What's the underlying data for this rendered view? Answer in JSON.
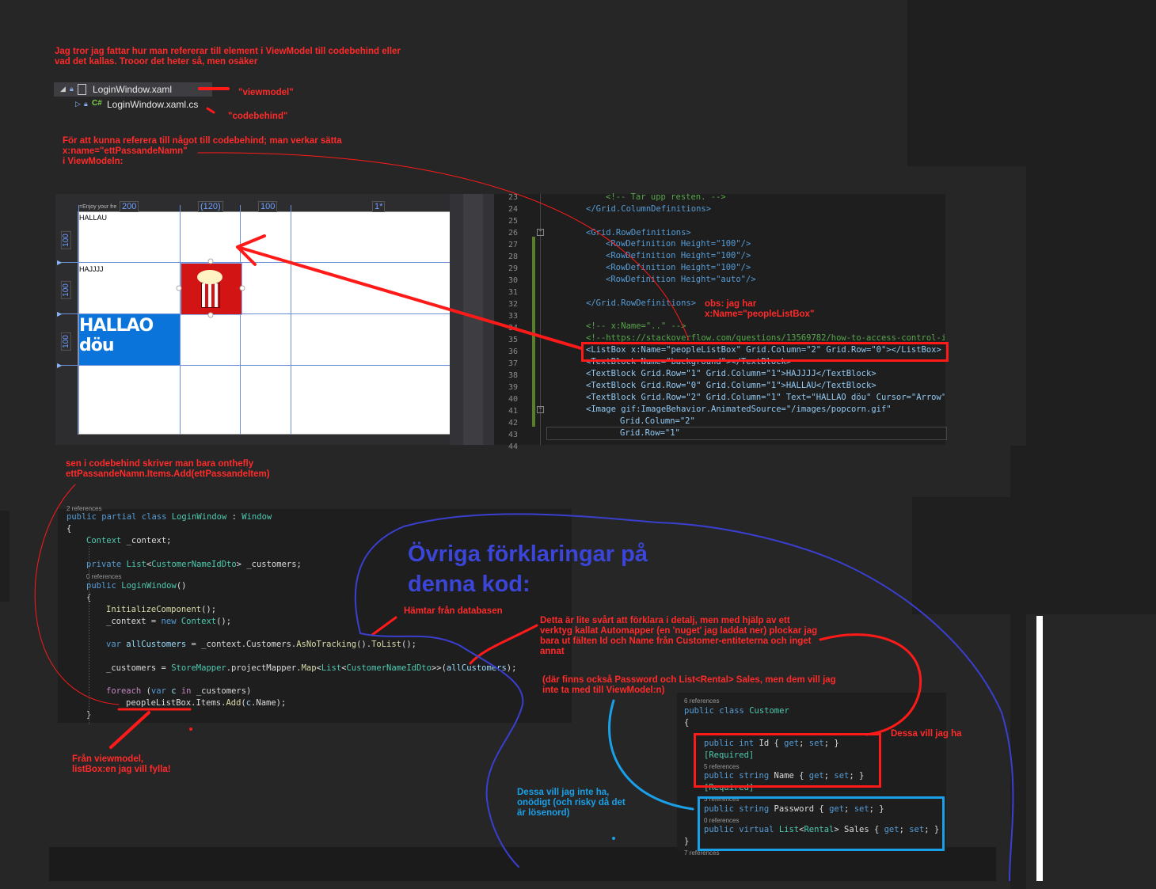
{
  "notes": {
    "intro": "Jag tror jag fattar hur man refererar till element i ViewModel till codebehind eller\nvad det kallas. Trooor det heter så, men osäker",
    "viewmodel": "\"viewmodel\"",
    "codebehind": "\"codebehind\"",
    "xname": "För att kunna referera till något till codebehind; man verkar sätta\nx:name=\"ettPassandeNamn\"\ni ViewModeln:",
    "obs": "obs: jag har\nx:Name=\"peopleListBox\"",
    "sen": "sen i codebehind skriver man bara onthefly\nettPassandeNamn.Items.Add(ettPassandeItem)",
    "fran_vm": "Från viewmodel,\nlistBox:en jag vill fylla!",
    "hamtar": "Hämtar från databasen",
    "detta": "Detta är lite svårt att förklara i detalj, men med hjälp av ett\nverktyg kallat Automapper (en 'nuget' jag laddat ner) plockar jag\nbara ut fälten Id och Name från Customer-entiteterna och inget\nannat",
    "dar": "(där finns också Password och List<Rental> Sales, men dem vill jag\ninte ta med till ViewModel:n)",
    "dessa_ha": "Dessa vill jag ha",
    "dessa_inte": "Dessa vill jag inte ha,\nonödigt (och risky då det\när lösenord)",
    "ovriga": "Övriga förklaringar på\ndenna kod:"
  },
  "solution": {
    "xaml": "LoginWindow.xaml",
    "cs": "LoginWindow.xaml.cs",
    "cs_icon": "C#"
  },
  "designer": {
    "col_widths": [
      "200",
      "(120)",
      "100",
      "1*"
    ],
    "row_heights": [
      "100",
      "100",
      "100"
    ],
    "hint": "=Enjoy your fre",
    "hallau": "HALLAU",
    "hajjjj": "HAJJJJ",
    "hallao": "HALLAO döu"
  },
  "xaml_lines": {
    "numbers": [
      "23",
      "24",
      "25",
      "26",
      "27",
      "28",
      "29",
      "30",
      "31",
      "32",
      "33",
      "34",
      "35",
      "36",
      "37",
      "38",
      "39",
      "40",
      "41",
      "42",
      "43",
      "44"
    ]
  },
  "xaml_text": {
    "l23": "<!-- Tar upp resten. -->",
    "l24": "</Grid.ColumnDefinitions>",
    "l26": "<Grid.RowDefinitions>",
    "l27": "<RowDefinition Height=\"100\"/>",
    "l28": "<RowDefinition Height=\"100\"/>",
    "l29": "<RowDefinition Height=\"100\"/>",
    "l30": "<RowDefinition Height=\"auto\"/>",
    "l32": "</Grid.RowDefinitions>",
    "l34": "<!-- x:Name=\"..\" -->",
    "l35": "<!--https://stackoverflow.com/questions/13569782/how-to-access-control-in",
    "l36": "<ListBox x:Name=\"peopleListBox\" Grid.Column=\"2\" Grid.Row=\"0\"></ListBox>",
    "l37": "<TextBlock Name=\"background\"></TextBlock>",
    "l38": "<TextBlock Grid.Row=\"1\" Grid.Column=\"1\">HAJJJJ</TextBlock>",
    "l39": "<TextBlock Grid.Row=\"0\" Grid.Column=\"1\">HALLAU</TextBlock>",
    "l40": "<TextBlock Grid.Row=\"2\" Grid.Column=\"1\" Text=\"HALLAO döu\" Cursor=\"Arrow\"",
    "l41": "<Image gif:ImageBehavior.AnimatedSource=\"/images/popcorn.gif\"",
    "l42": "Grid.Column=\"2\"",
    "l43": "Grid.Row=\"1\""
  },
  "cs_code": {
    "refs_top": "2 references",
    "l1": "public partial class LoginWindow : Window",
    "l2": "{",
    "l3": "Context _context;",
    "l4": "private List<CustomerNameIdDto> _customers;",
    "refs0": "0 references",
    "l5": "public LoginWindow()",
    "l6": "{",
    "l7": "InitializeComponent();",
    "l8": "_context = new Context();",
    "l9": "var allCustomers = _context.Customers.AsNoTracking().ToList();",
    "l10": "_customers = StoreMapper.projectMapper.Map<List<CustomerNameIdDto>>(allCustomers);",
    "l11": "foreach (var c in _customers)",
    "l12": "peopleListBox.Items.Add(c.Name);",
    "l13": "}"
  },
  "customer_code": {
    "refs6": "6 references",
    "l1": "public class Customer",
    "l2": "{",
    "id": "public int Id { get; set; }",
    "req1": "[Required]",
    "refs5": "5 references",
    "name": "public string Name { get; set; }",
    "req2": "[Required]",
    "refs3": "3 references",
    "pwd": "public string Password { get; set; }",
    "refs0": "0 references",
    "sales": "public virtual List<Rental> Sales { get; set; }",
    "close": "}",
    "refs7": "7 references"
  },
  "colors": {
    "annotation_red": "#ff2a2a",
    "pen_blue": "#3a3fd0",
    "box_cyan": "#1aa0e8",
    "vs_dark": "#1e1e1e"
  }
}
